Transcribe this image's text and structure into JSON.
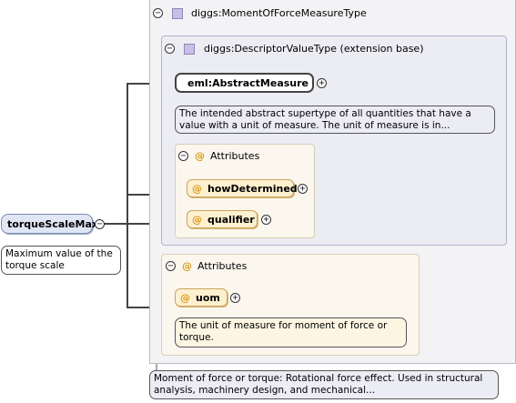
{
  "root_element": {
    "name": "torqueScaleMax",
    "documentation": "Maximum value of the torque scale"
  },
  "complex_type": {
    "name": "diggs:MomentOfForceMeasureType",
    "documentation": "Moment of force or torque: Rotational force effect. Used in structural analysis, machinery design, and mechanical..."
  },
  "extension_base": {
    "name": "diggs:DescriptorValueType (extension base)",
    "abstract_element": "eml:AbstractMeasure",
    "abstract_documentation": "The intended abstract supertype of all quantities that have a value with a unit of measure. The unit of measure is in...",
    "attributes_header": "Attributes",
    "attributes": [
      "howDetermined",
      "qualifier"
    ]
  },
  "own_attributes": {
    "header": "Attributes",
    "attribute": "uom",
    "documentation": "The unit of measure for moment of force or torque."
  },
  "symbols": {
    "collapse": "⊖",
    "expand": "+",
    "attribute_marker": "@"
  },
  "colors": {
    "type_icon": "#c9bfe6",
    "attribute_marker": "#d89a1a",
    "element_pill": "#dfe6f6",
    "attribute_pill": "#fdf0cf"
  }
}
